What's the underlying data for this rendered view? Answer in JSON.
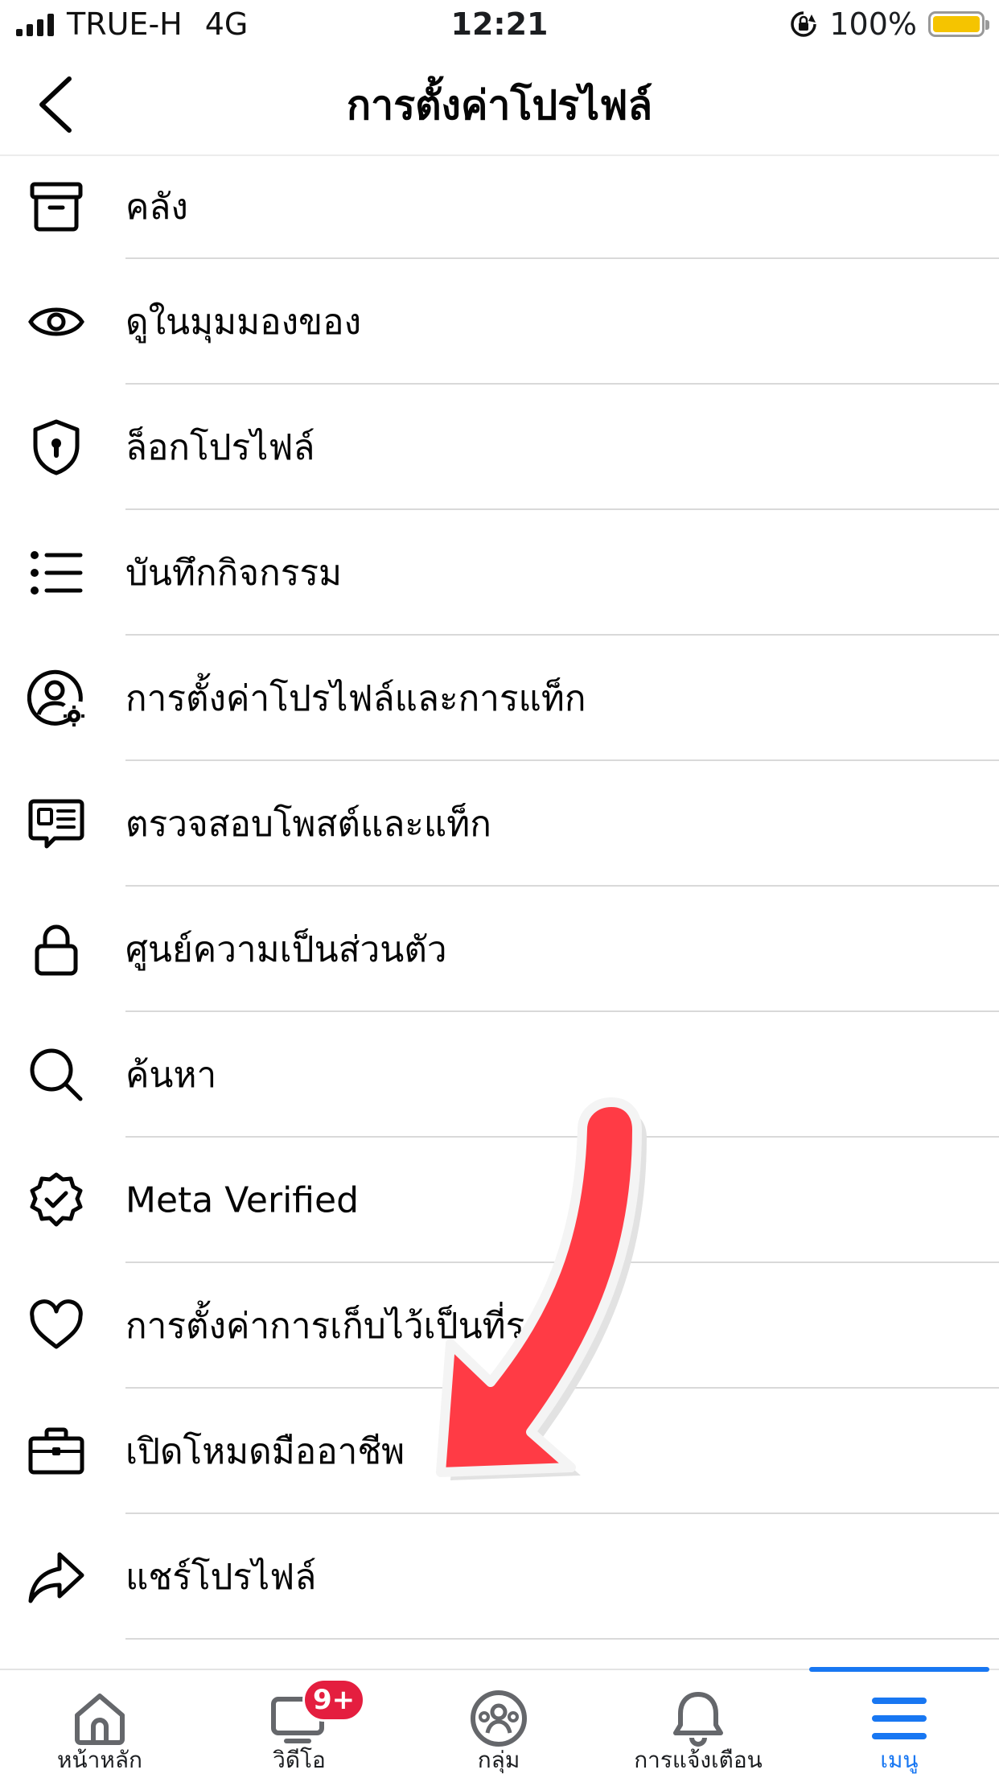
{
  "status_bar": {
    "carrier": "TRUE-H",
    "network": "4G",
    "time": "12:21",
    "battery": "100%",
    "battery_color": "#f5c400"
  },
  "header": {
    "title": "การตั้งค่าโปรไฟล์",
    "back_icon": "chevron-left-icon"
  },
  "menu": {
    "items": [
      {
        "label": "คลัง",
        "icon": "archive-box-icon"
      },
      {
        "label": "ดูในมุมมองของ",
        "icon": "eye-icon"
      },
      {
        "label": "ล็อกโปรไฟล์",
        "icon": "shield-lock-icon"
      },
      {
        "label": "บันทึกกิจกรรม",
        "icon": "list-icon"
      },
      {
        "label": "การตั้งค่าโปรไฟล์และการแท็ก",
        "icon": "user-gear-icon"
      },
      {
        "label": "ตรวจสอบโพสต์และแท็ก",
        "icon": "review-post-icon"
      },
      {
        "label": "ศูนย์ความเป็นส่วนตัว",
        "icon": "lock-icon"
      },
      {
        "label": "ค้นหา",
        "icon": "search-icon"
      },
      {
        "label": "Meta Verified",
        "icon": "verified-badge-icon"
      },
      {
        "label": "การตั้งค่าการเก็บไว้เป็นที่ระลึก",
        "icon": "heart-icon"
      },
      {
        "label": "เปิดโหมดมืออาชีพ",
        "icon": "briefcase-icon"
      },
      {
        "label": "แชร์โปรไฟล์",
        "icon": "share-arrow-icon"
      }
    ]
  },
  "annotation": {
    "arrow_icon": "red-pointer-arrow-icon",
    "arrow_color": "#ff3b45"
  },
  "tab_bar": {
    "tabs": [
      {
        "label": "หน้าหลัก",
        "icon": "home-icon"
      },
      {
        "label": "วิดีโอ",
        "icon": "video-icon",
        "badge": "9+"
      },
      {
        "label": "กลุ่ม",
        "icon": "groups-icon"
      },
      {
        "label": "การแจ้งเตือน",
        "icon": "bell-icon"
      },
      {
        "label": "เมนู",
        "icon": "menu-icon",
        "active": true
      }
    ],
    "accent_color": "#1877f2",
    "badge_color": "#e41e3f"
  }
}
